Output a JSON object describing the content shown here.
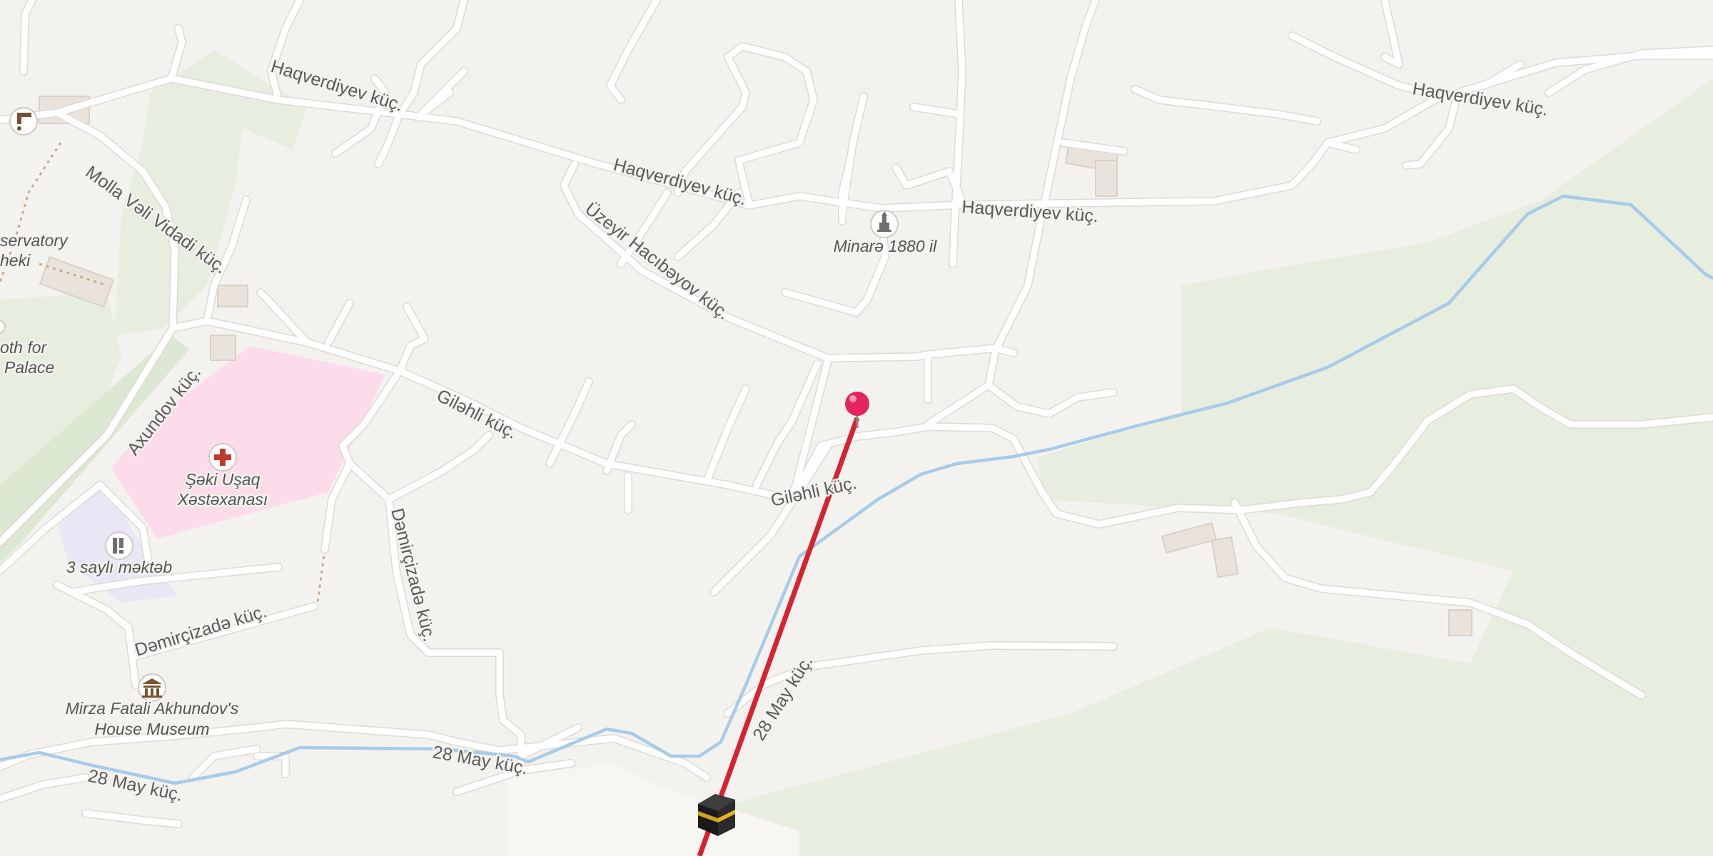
{
  "colors": {
    "background": "#f4f2ef",
    "road": "#ffffff",
    "river": "#a7cbe9",
    "park": "#e7eddf",
    "hospital": "#fcdcea",
    "school": "#ebe6f6",
    "qibla_line": "#d5242f",
    "pin": "#e5245e"
  },
  "streets": {
    "haqverdiyev_1": "Haqverdiyev küç.",
    "haqverdiyev_2": "Haqverdiyev küç.",
    "haqverdiyev_3": "Haqverdiyev küç.",
    "haqverdiyev_4": "Haqverdiyev küç.",
    "molla_veli_vidadi": "Molla Vəli Vidadi küç.",
    "uzeyir_hacibeyov": "Üzeyir Hacıbəyov küç.",
    "axundov": "Axundov küç.",
    "gilehli_1": "Giləhli küç.",
    "gilehli_2": "Giləhli küç.",
    "demircizade_1": "Dəmirçizadə küç.",
    "demircizade_2": "Dəmirçizadə küç.",
    "may28_1": "28 May küç.",
    "may28_2": "28 May küç.",
    "may28_3": "28 May küç."
  },
  "pois": {
    "minare": {
      "label": "Minarə 1880 il",
      "icon": "minaret-icon"
    },
    "hospital": {
      "label_line1": "Şəki Uşaq",
      "label_line2": "Xəstəxanası",
      "icon": "hospital-cross-icon"
    },
    "school": {
      "label": "3 saylı məktəb",
      "icon": "school-icon"
    },
    "museum": {
      "label_line1": "Mirza Fatali Akhundov's",
      "label_line2": "House Museum",
      "icon": "museum-icon"
    },
    "observatory": {
      "label_line1": "servatory",
      "label_line2": "heki"
    },
    "palace_booth": {
      "label_line1": "oth for",
      "label_line2": "Palace"
    },
    "water_tap": {
      "icon": "water-tap-icon"
    }
  },
  "markers": {
    "location_pin": "location-pin-icon",
    "kaaba": "kaaba-icon"
  }
}
